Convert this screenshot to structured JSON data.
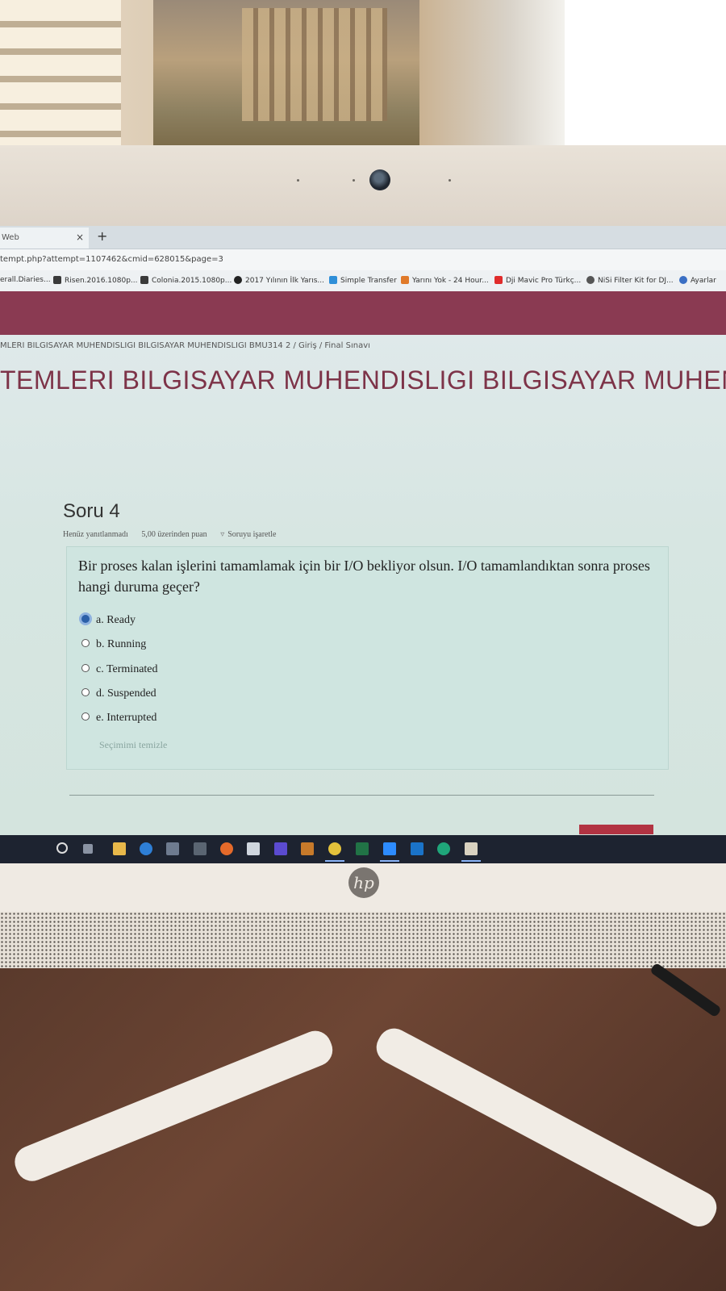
{
  "browser": {
    "tab_title": "Web",
    "tab_close": "×",
    "new_tab": "+",
    "url": "tempt.php?attempt=1107462&cmid=628015&page=3",
    "bookmarks": [
      {
        "label": "erall.Diaries..."
      },
      {
        "label": "Risen.2016.1080p..."
      },
      {
        "label": "Colonia.2015.1080p..."
      },
      {
        "label": "2017 Yılının İlk Yarıs..."
      },
      {
        "label": "Simple Transfer"
      },
      {
        "label": "Yarını Yok - 24 Hour..."
      },
      {
        "label": "Dji Mavic Pro Türkç..."
      },
      {
        "label": "NiSi Filter Kit for DJ..."
      },
      {
        "label": "Ayarlar"
      }
    ]
  },
  "page": {
    "breadcrumb": "MLERI BILGISAYAR MUHENDISLIGI BILGISAYAR MUHENDISLIGI BMU314 2  /  Giriş  /  Final Sınavı",
    "course_title": "TEMLERI BILGISAYAR MUHENDISLIGI BILGISAYAR MUHENDI"
  },
  "question": {
    "heading": "Soru 4",
    "status": "Henüz yanıtlanmadı",
    "points": "5,00 üzerinden puan",
    "flag_label": "Soruyu işaretle",
    "text": "Bir proses kalan işlerini tamamlamak için bir I/O bekliyor olsun. I/O tamamlandıktan sonra proses hangi duruma geçer?",
    "options": [
      {
        "label": "a. Ready",
        "selected": true
      },
      {
        "label": "b. Running",
        "selected": false
      },
      {
        "label": "c. Terminated",
        "selected": false
      },
      {
        "label": "d. Suspended",
        "selected": false
      },
      {
        "label": "e. Interrupted",
        "selected": false
      }
    ],
    "clear_choice": "Seçimimi temizle"
  },
  "brand": {
    "logo_text": "hp"
  },
  "colors": {
    "brand_bar": "#8a3a52",
    "course_title": "#7d3348",
    "question_box": "#cfe5e0",
    "selected_radio": "#2b5fa8"
  }
}
